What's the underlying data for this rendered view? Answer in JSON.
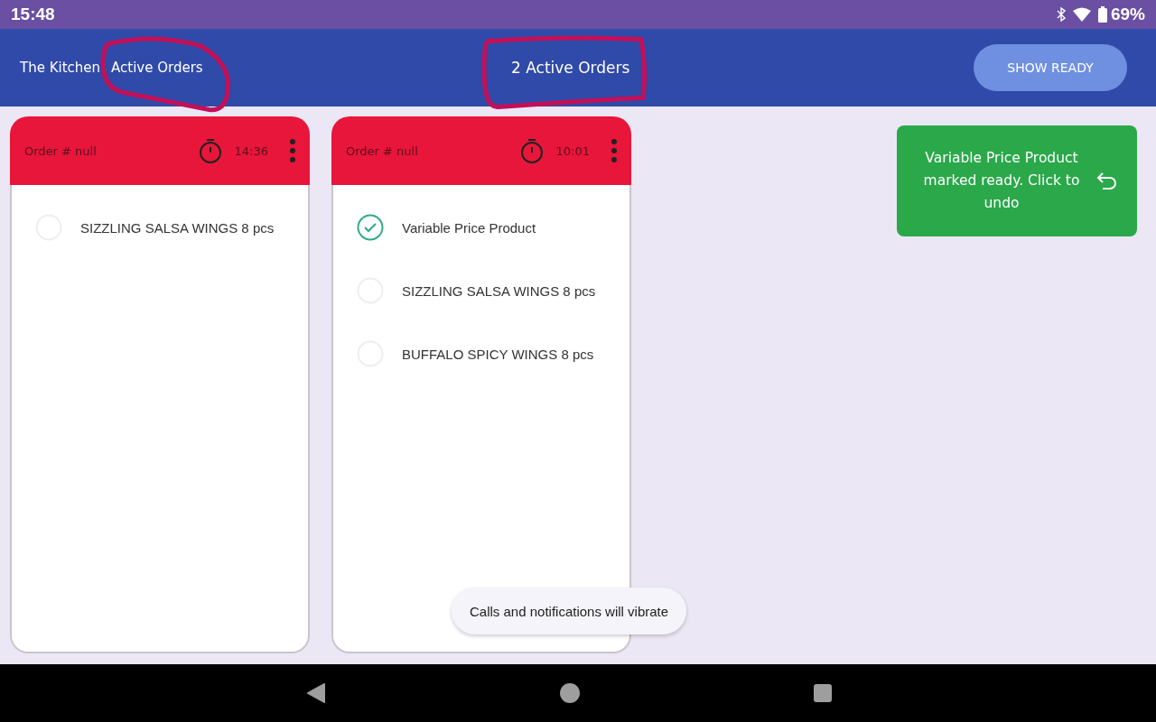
{
  "status_bar": {
    "time": "15:48",
    "battery": "69%"
  },
  "app_bar": {
    "title": "The Kitchen",
    "subtitle": "Active Orders",
    "count": "2 Active Orders",
    "button": "SHOW READY"
  },
  "orders": [
    {
      "title": "Order # null",
      "timer": "14:36",
      "items": [
        {
          "name": "SIZZLING SALSA WINGS 8 pcs",
          "checked": false
        }
      ]
    },
    {
      "title": "Order # null",
      "timer": "10:01",
      "items": [
        {
          "name": "Variable Price Product",
          "checked": true
        },
        {
          "name": "SIZZLING SALSA WINGS 8 pcs",
          "checked": false
        },
        {
          "name": "BUFFALO SPICY WINGS 8 pcs",
          "checked": false
        }
      ]
    }
  ],
  "notice": {
    "text": "Variable Price Product marked ready. Click to undo"
  },
  "toast": {
    "text": "Calls and notifications will vibrate"
  }
}
